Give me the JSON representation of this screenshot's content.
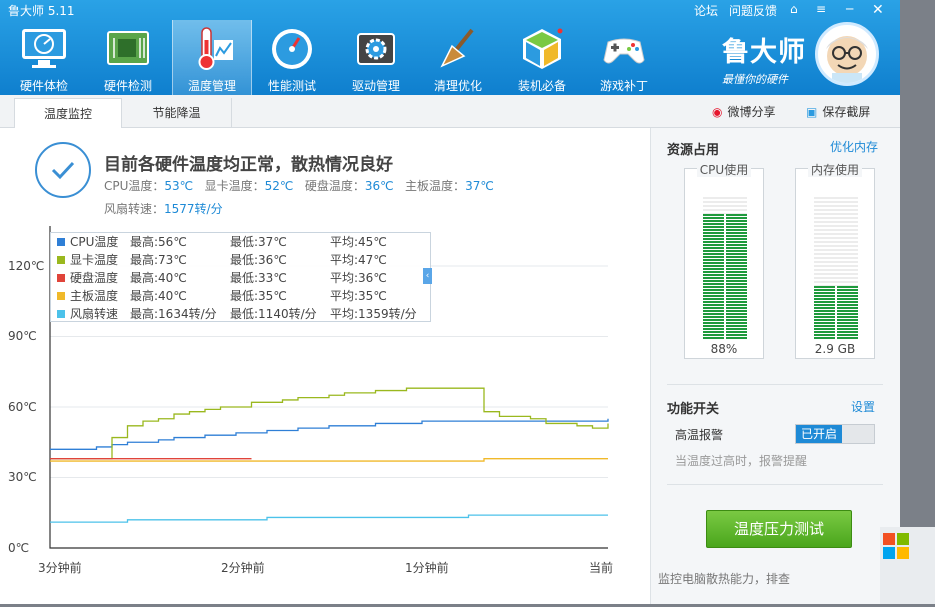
{
  "app": {
    "title": "鲁大师 5.11"
  },
  "window_controls": {
    "forum": "论坛",
    "feedback": "问题反馈"
  },
  "nav": [
    {
      "label": "硬件体检",
      "icon": "monitor-check-icon"
    },
    {
      "label": "硬件检测",
      "icon": "board-chip-icon"
    },
    {
      "label": "温度管理",
      "icon": "thermometer-icon",
      "active": true
    },
    {
      "label": "性能测试",
      "icon": "speedometer-icon"
    },
    {
      "label": "驱动管理",
      "icon": "driver-gear-icon"
    },
    {
      "label": "清理优化",
      "icon": "broom-icon"
    },
    {
      "label": "装机必备",
      "icon": "cube-icon"
    },
    {
      "label": "游戏补丁",
      "icon": "gamepad-icon"
    }
  ],
  "brand": {
    "name": "鲁大师",
    "slogan": "最懂你的硬件"
  },
  "subtabs": [
    {
      "label": "温度监控",
      "active": true
    },
    {
      "label": "节能降温"
    }
  ],
  "share": {
    "weibo": "微博分享",
    "screenshot": "保存截屏"
  },
  "status": {
    "title": "目前各硬件温度均正常，散热情况良好",
    "cpu_label": "CPU温度：",
    "cpu": "53℃",
    "gpu_label": "显卡温度：",
    "gpu": "52℃",
    "disk_label": "硬盘温度：",
    "disk": "36℃",
    "board_label": "主板温度：",
    "board": "37℃",
    "fan_label": "风扇转速：",
    "fan": "1577转/分"
  },
  "legend": [
    {
      "name": "CPU温度",
      "max": "最高:56℃",
      "min": "最低:37℃",
      "avg": "平均:45℃",
      "color": "#2f7fd6"
    },
    {
      "name": "显卡温度",
      "max": "最高:73℃",
      "min": "最低:36℃",
      "avg": "平均:47℃",
      "color": "#9ab81e"
    },
    {
      "name": "硬盘温度",
      "max": "最高:40℃",
      "min": "最低:33℃",
      "avg": "平均:36℃",
      "color": "#e0443a"
    },
    {
      "name": "主板温度",
      "max": "最高:40℃",
      "min": "最低:35℃",
      "avg": "平均:35℃",
      "color": "#f0b92a"
    },
    {
      "name": "风扇转速",
      "max": "最高:1634转/分",
      "min": "最低:1140转/分",
      "avg": "平均:1359转/分",
      "color": "#4cc2ea"
    }
  ],
  "chart_data": {
    "type": "line",
    "y_ticks": [
      "120℃",
      "90℃",
      "60℃",
      "30℃",
      "0℃"
    ],
    "x_ticks": [
      "3分钟前",
      "2分钟前",
      "1分钟前",
      "当前"
    ],
    "ylim": [
      0,
      120
    ],
    "x": [
      0,
      5,
      10,
      15,
      20,
      25,
      30,
      35,
      40,
      45,
      50,
      55,
      60,
      65,
      70,
      75,
      80,
      85,
      90,
      95,
      100,
      105,
      110,
      115,
      120,
      125,
      130,
      135,
      140,
      145,
      150,
      155,
      160,
      165,
      170,
      175,
      180
    ],
    "series": [
      {
        "name": "CPU温度",
        "color": "#2f7fd6",
        "values": [
          42,
          42,
          42,
          43,
          44,
          45,
          45,
          46,
          47,
          47,
          48,
          48,
          49,
          49,
          50,
          50,
          51,
          51,
          52,
          52,
          52,
          53,
          53,
          53,
          54,
          54,
          54,
          54,
          54,
          54,
          54,
          54,
          54,
          54,
          54,
          54,
          55
        ]
      },
      {
        "name": "显卡温度",
        "color": "#9ab81e",
        "values": [
          38,
          38,
          38,
          38,
          47,
          52,
          54,
          55,
          57,
          58,
          59,
          60,
          60,
          62,
          62,
          63,
          64,
          64,
          65,
          66,
          66,
          67,
          67,
          68,
          68,
          68,
          68,
          68,
          58,
          56,
          56,
          55,
          53,
          53,
          52,
          51,
          53
        ]
      },
      {
        "name": "硬盘温度",
        "color": "#e0443a",
        "values": [
          38,
          38,
          38,
          38,
          38,
          38,
          38,
          38,
          38,
          38,
          38,
          38,
          38,
          38,
          null,
          null,
          null,
          null,
          null,
          null,
          null,
          null,
          null,
          null,
          null,
          null,
          null,
          null,
          null,
          null,
          null,
          null,
          null,
          null,
          null,
          null,
          null
        ]
      },
      {
        "name": "主板温度",
        "color": "#f0b92a",
        "values": [
          37,
          37,
          37,
          37,
          37,
          37,
          37,
          37,
          37,
          37,
          37,
          37,
          37,
          37,
          37,
          37,
          37,
          37,
          37,
          37,
          37,
          37,
          37,
          37,
          37,
          37,
          37,
          37,
          38,
          38,
          38,
          38,
          38,
          38,
          38,
          38,
          38
        ]
      },
      {
        "name": "风扇转速",
        "color": "#4cc2ea",
        "values": [
          11,
          11,
          11,
          11,
          11,
          12,
          12,
          12,
          12,
          12,
          12,
          12,
          12,
          12,
          13,
          13,
          13,
          13,
          13,
          13,
          13,
          13,
          13,
          13,
          13,
          13,
          13,
          14,
          14,
          14,
          14,
          14,
          14,
          14,
          14,
          14,
          14
        ]
      }
    ]
  },
  "resources": {
    "title": "资源占用",
    "optimize": "优化内存",
    "cpu_title": "CPU使用",
    "cpu_value": "88%",
    "cpu_fraction": 0.88,
    "mem_title": "内存使用",
    "mem_value": "2.9 GB",
    "mem_fraction": 0.37
  },
  "functions": {
    "title": "功能开关",
    "settings": "设置",
    "alarm_label": "高温报警",
    "alarm_state": "已开启",
    "alarm_desc": "当温度过高时，报警提醒"
  },
  "test_button": "温度压力测试",
  "bottom_tip": "监控电脑散热能力，排查"
}
